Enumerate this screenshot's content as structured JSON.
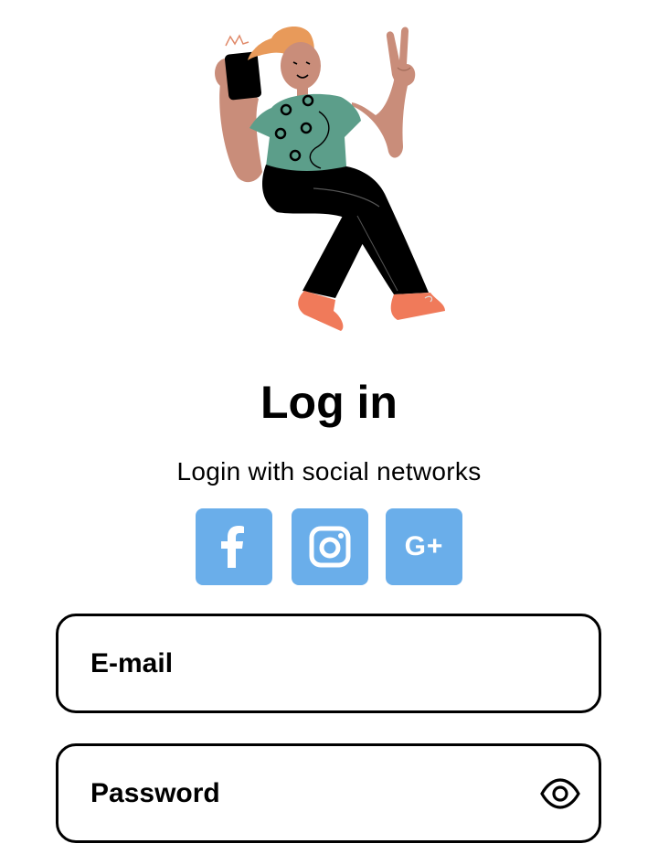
{
  "header": {
    "illustration_icon": "person-with-phone-illustration"
  },
  "title": "Log in",
  "subtitle": "Login with social networks",
  "social": {
    "facebook_icon": "facebook-icon",
    "instagram_icon": "instagram-icon",
    "google_plus_icon": "google-plus-icon",
    "google_plus_label": "G+",
    "color": "#6aaeea"
  },
  "form": {
    "email": {
      "placeholder": "E-mail",
      "value": ""
    },
    "password": {
      "placeholder": "Password",
      "value": "",
      "toggle_icon": "eye-icon"
    }
  }
}
